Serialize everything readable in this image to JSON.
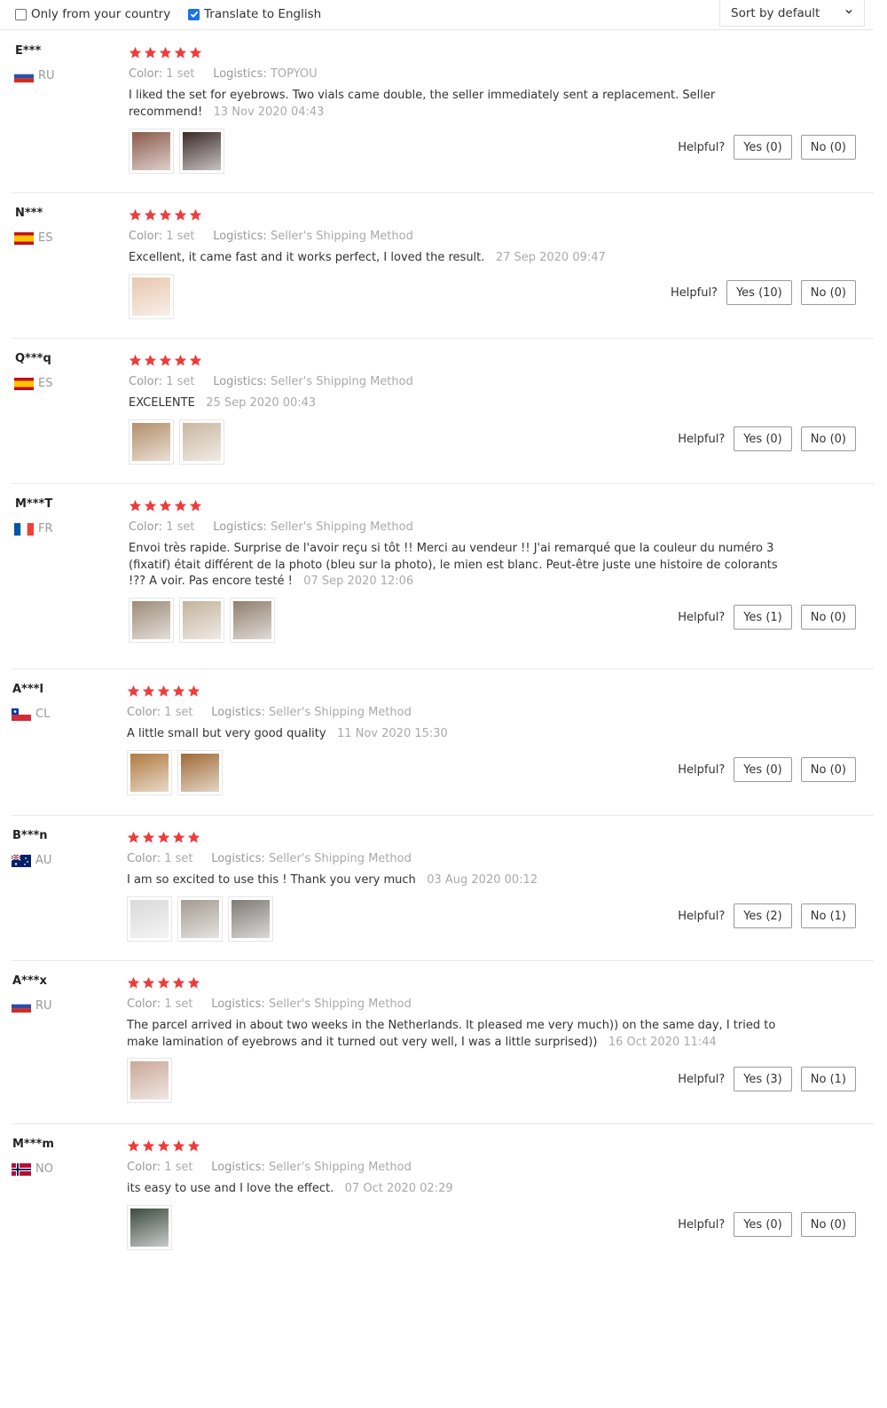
{
  "filters": {
    "only_country_label": "Only from your country",
    "only_country_checked": false,
    "translate_label": "Translate to English",
    "translate_checked": true,
    "sort_label": "Sort by default"
  },
  "colors": {
    "star": "#ee3b3b",
    "checkbox": "#1a73e8"
  },
  "labels": {
    "color": "Color:",
    "logistics": "Logistics:",
    "helpful": "Helpful?"
  },
  "reviews": [
    {
      "user": "E***",
      "country": "RU",
      "flag": "ru",
      "stars": 5,
      "color": "1 set",
      "logistics": "TOPYOU",
      "text": "I liked the set for eyebrows. Two vials came double, the seller immediately sent a replacement. Seller recommend!",
      "date": "13 Nov 2020 04:43",
      "photos": 2,
      "yes": "Yes (0)",
      "no": "No (0)"
    },
    {
      "user": "N***",
      "country": "ES",
      "flag": "es",
      "stars": 5,
      "color": "1 set",
      "logistics": "Seller's Shipping Method",
      "text": "Excellent, it came fast and it works perfect, I loved the result.",
      "date": "27 Sep 2020 09:47",
      "photos": 1,
      "yes": "Yes (10)",
      "no": "No (0)"
    },
    {
      "user": "Q***q",
      "country": "ES",
      "flag": "es",
      "stars": 5,
      "color": "1 set",
      "logistics": "Seller's Shipping Method",
      "text": "EXCELENTE",
      "date": "25 Sep 2020 00:43",
      "photos": 2,
      "yes": "Yes (0)",
      "no": "No (0)"
    },
    {
      "user": "M***T",
      "country": "FR",
      "flag": "fr",
      "stars": 5,
      "color": "1 set",
      "logistics": "Seller's Shipping Method",
      "text": "Envoi très rapide. Surprise de l'avoir reçu si tôt !! Merci au vendeur !! J'ai remarqué que la couleur du numéro 3 (fixatif) était différent de la photo (bleu sur la photo), le mien est blanc. Peut-être juste une histoire de colorants !?? A voir. Pas encore testé !",
      "date": "07 Sep 2020 12:06",
      "photos": 3,
      "yes": "Yes (1)",
      "no": "No (0)"
    },
    {
      "user": "A***l",
      "country": "CL",
      "flag": "cl",
      "stars": 5,
      "color": "1 set",
      "logistics": "Seller's Shipping Method",
      "text": "A little small but very good quality",
      "date": "11 Nov 2020 15:30",
      "photos": 2,
      "yes": "Yes (0)",
      "no": "No (0)"
    },
    {
      "user": "B***n",
      "country": "AU",
      "flag": "au",
      "stars": 5,
      "color": "1 set",
      "logistics": "Seller's Shipping Method",
      "text": "I am so excited to use this ! Thank you very much",
      "date": "03 Aug 2020 00:12",
      "photos": 3,
      "yes": "Yes (2)",
      "no": "No (1)"
    },
    {
      "user": "A***x",
      "country": "RU",
      "flag": "ru",
      "stars": 5,
      "color": "1 set",
      "logistics": "Seller's Shipping Method",
      "text": "The parcel arrived in about two weeks in the Netherlands. It pleased me very much)) on the same day, I tried to make lamination of eyebrows and it turned out very well, I was a little surprised))",
      "date": "16 Oct 2020 11:44",
      "photos": 1,
      "yes": "Yes (3)",
      "no": "No (1)"
    },
    {
      "user": "M***m",
      "country": "NO",
      "flag": "no",
      "stars": 5,
      "color": "1 set",
      "logistics": "Seller's Shipping Method",
      "text": "its easy to use and I love the effect.",
      "date": "07 Oct 2020 02:29",
      "photos": 1,
      "yes": "Yes (0)",
      "no": "No (0)"
    }
  ]
}
